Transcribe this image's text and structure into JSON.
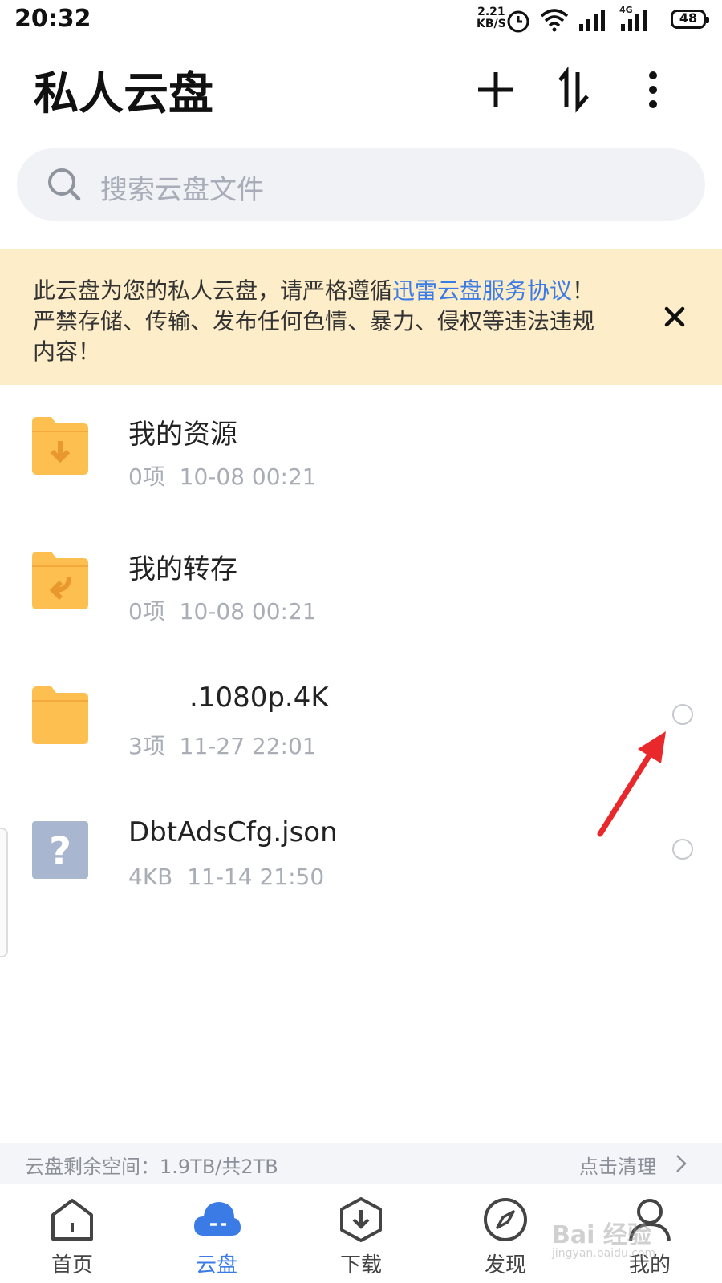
{
  "status_bar": {
    "time": "20:32",
    "speed_value": "2.21",
    "speed_unit": "KB/S",
    "network_type": "4G",
    "battery": "48"
  },
  "header": {
    "title": "私人云盘",
    "add_icon": "plus-icon",
    "sort_icon": "sort-icon",
    "more_icon": "more-vertical-icon"
  },
  "search": {
    "placeholder": "搜索云盘文件"
  },
  "notice": {
    "text_before": "此云盘为您的私人云盘，请严格遵循",
    "link_text": "迅雷云盘服务协议",
    "text_after": "！严禁存储、传输、发布任何色情、暴力、侵权等违法违规内容！",
    "link_color": "#3a7be6",
    "background": "#fdedc9"
  },
  "files": [
    {
      "name": "我的资源",
      "count": "0项",
      "date": "10-08 00:21",
      "icon": "download-folder-icon",
      "selectable": false
    },
    {
      "name": "我的转存",
      "count": "0项",
      "date": "10-08 00:21",
      "icon": "transfer-folder-icon",
      "selectable": false
    },
    {
      "name": ".1080p.4K",
      "count": "3项",
      "date": "11-27 22:01",
      "icon": "folder-icon",
      "selectable": true
    },
    {
      "name": "DbtAdsCfg.json",
      "count": "4KB",
      "date": "11-14 21:50",
      "icon": "unknown-file-icon",
      "selectable": true
    }
  ],
  "storage": {
    "text": "云盘剩余空间：1.9TB/共2TB",
    "clean_label": "点击清理"
  },
  "tabs": [
    {
      "label": "首页",
      "icon": "home-icon",
      "active": false
    },
    {
      "label": "云盘",
      "icon": "cloud-icon",
      "active": true
    },
    {
      "label": "下载",
      "icon": "download-icon",
      "active": false
    },
    {
      "label": "发现",
      "icon": "compass-icon",
      "active": false
    },
    {
      "label": "我的",
      "icon": "profile-icon",
      "active": false
    }
  ],
  "watermark": {
    "text": "Bai 经验",
    "sub": "jingyan.baidu.com"
  },
  "colors": {
    "accent": "#3a7be6",
    "folder": "#fdbf4f",
    "annotation_arrow": "#e8282a"
  }
}
